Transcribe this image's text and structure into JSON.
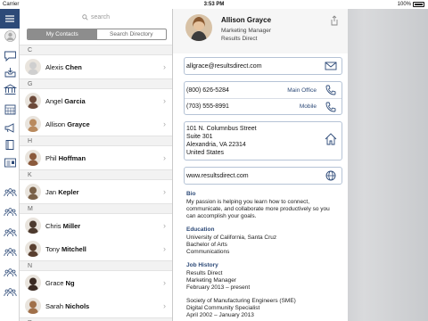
{
  "status_bar": {
    "carrier": "Carrier",
    "time": "3:53 PM",
    "battery": "100%"
  },
  "rail": {
    "icons": [
      "menu-icon",
      "avatar-icon",
      "chat-icon",
      "inbox-icon",
      "bank-icon",
      "calendar-icon",
      "megaphone-icon",
      "book-icon",
      "id-card-icon",
      "group-icon",
      "group-icon",
      "group-icon",
      "group-icon",
      "group-icon",
      "group-icon"
    ]
  },
  "contacts": {
    "search_placeholder": "search",
    "tabs": [
      "My Contacts",
      "Search Directory"
    ],
    "sections": [
      {
        "letter": "C",
        "people": [
          {
            "first": "Alexis",
            "last": "Chen",
            "avatar_color": "#cfcfcf"
          }
        ]
      },
      {
        "letter": "G",
        "people": [
          {
            "first": "Angel",
            "last": "Garcia",
            "avatar_color": "#6d4a3a"
          },
          {
            "first": "Allison",
            "last": "Grayce",
            "avatar_color": "#b98a5e"
          }
        ]
      },
      {
        "letter": "H",
        "people": [
          {
            "first": "Phil",
            "last": "Hoffman",
            "avatar_color": "#8b5a3c"
          }
        ]
      },
      {
        "letter": "K",
        "people": [
          {
            "first": "Jan",
            "last": "Kepler",
            "avatar_color": "#7a6148"
          }
        ]
      },
      {
        "letter": "M",
        "people": [
          {
            "first": "Chris",
            "last": "Miller",
            "avatar_color": "#4d3a2e"
          },
          {
            "first": "Tony",
            "last": "Mitchell",
            "avatar_color": "#5a4030"
          }
        ]
      },
      {
        "letter": "N",
        "people": [
          {
            "first": "Grace",
            "last": "Ng",
            "avatar_color": "#3a2a22"
          },
          {
            "first": "Sarah",
            "last": "Nichols",
            "avatar_color": "#a0704a"
          }
        ]
      },
      {
        "letter": "R",
        "people": []
      }
    ]
  },
  "detail": {
    "name": "Allison Grayce",
    "title": "Marketing Manager",
    "company": "Results Direct",
    "email": "allgrace@resultsdirect.com",
    "phones": [
      {
        "number": "(800) 626-5284",
        "label": "Main Office"
      },
      {
        "number": "(703) 555-8991",
        "label": "Mobile"
      }
    ],
    "address": [
      "101 N. Columnbus Street",
      "Suite 301",
      "Alexandria, VA 22314",
      "United States"
    ],
    "website": "www.resultsdirect.com",
    "bio_heading": "Bio",
    "bio": "My passion is helping you learn how to connect, communicate, and collaborate more productively so you can accomplish your goals.",
    "education_heading": "Education",
    "education": [
      "University of California, Santa Cruz",
      "Bachelor of Arts",
      "Communications"
    ],
    "job_heading": "Job History",
    "jobs": [
      [
        "Results Direct",
        "Marketing Manager",
        "February 2013 – present"
      ],
      [
        "Society of Manufacturing Engineers (SME)",
        "Digital Community Specialist",
        "April 2002 – January 2013"
      ]
    ]
  },
  "colors": {
    "accent": "#2d4a78"
  }
}
